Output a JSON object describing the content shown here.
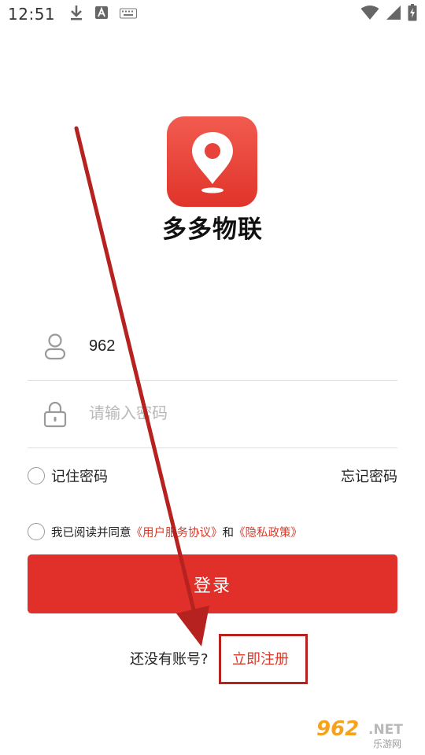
{
  "status_bar": {
    "time": "12:51",
    "icons": [
      "download-icon",
      "font-a-icon",
      "keyboard-icon",
      "wifi-icon",
      "signal-icon",
      "battery-charging-icon"
    ]
  },
  "app": {
    "name": "多多物联",
    "logo_icon": "location-pin-icon",
    "brand_color": "#e3352b"
  },
  "login_form": {
    "username_value": "962",
    "password_placeholder": "请输入密码",
    "remember_label": "记住密码",
    "forgot_label": "忘记密码",
    "agreement_prefix": "我已阅读并同意",
    "user_agreement_link": "《用户服务协议》",
    "agreement_and": "和",
    "privacy_link": "《隐私政策》",
    "login_button": "登录",
    "no_account_text": "还没有账号?",
    "register_link": "立即注册"
  },
  "watermark": {
    "number": "962",
    "suffix": ".NET",
    "site_name": "乐游网"
  },
  "colors": {
    "accent": "#e1302a",
    "link": "#d83a2a",
    "annotation": "#b52220"
  }
}
